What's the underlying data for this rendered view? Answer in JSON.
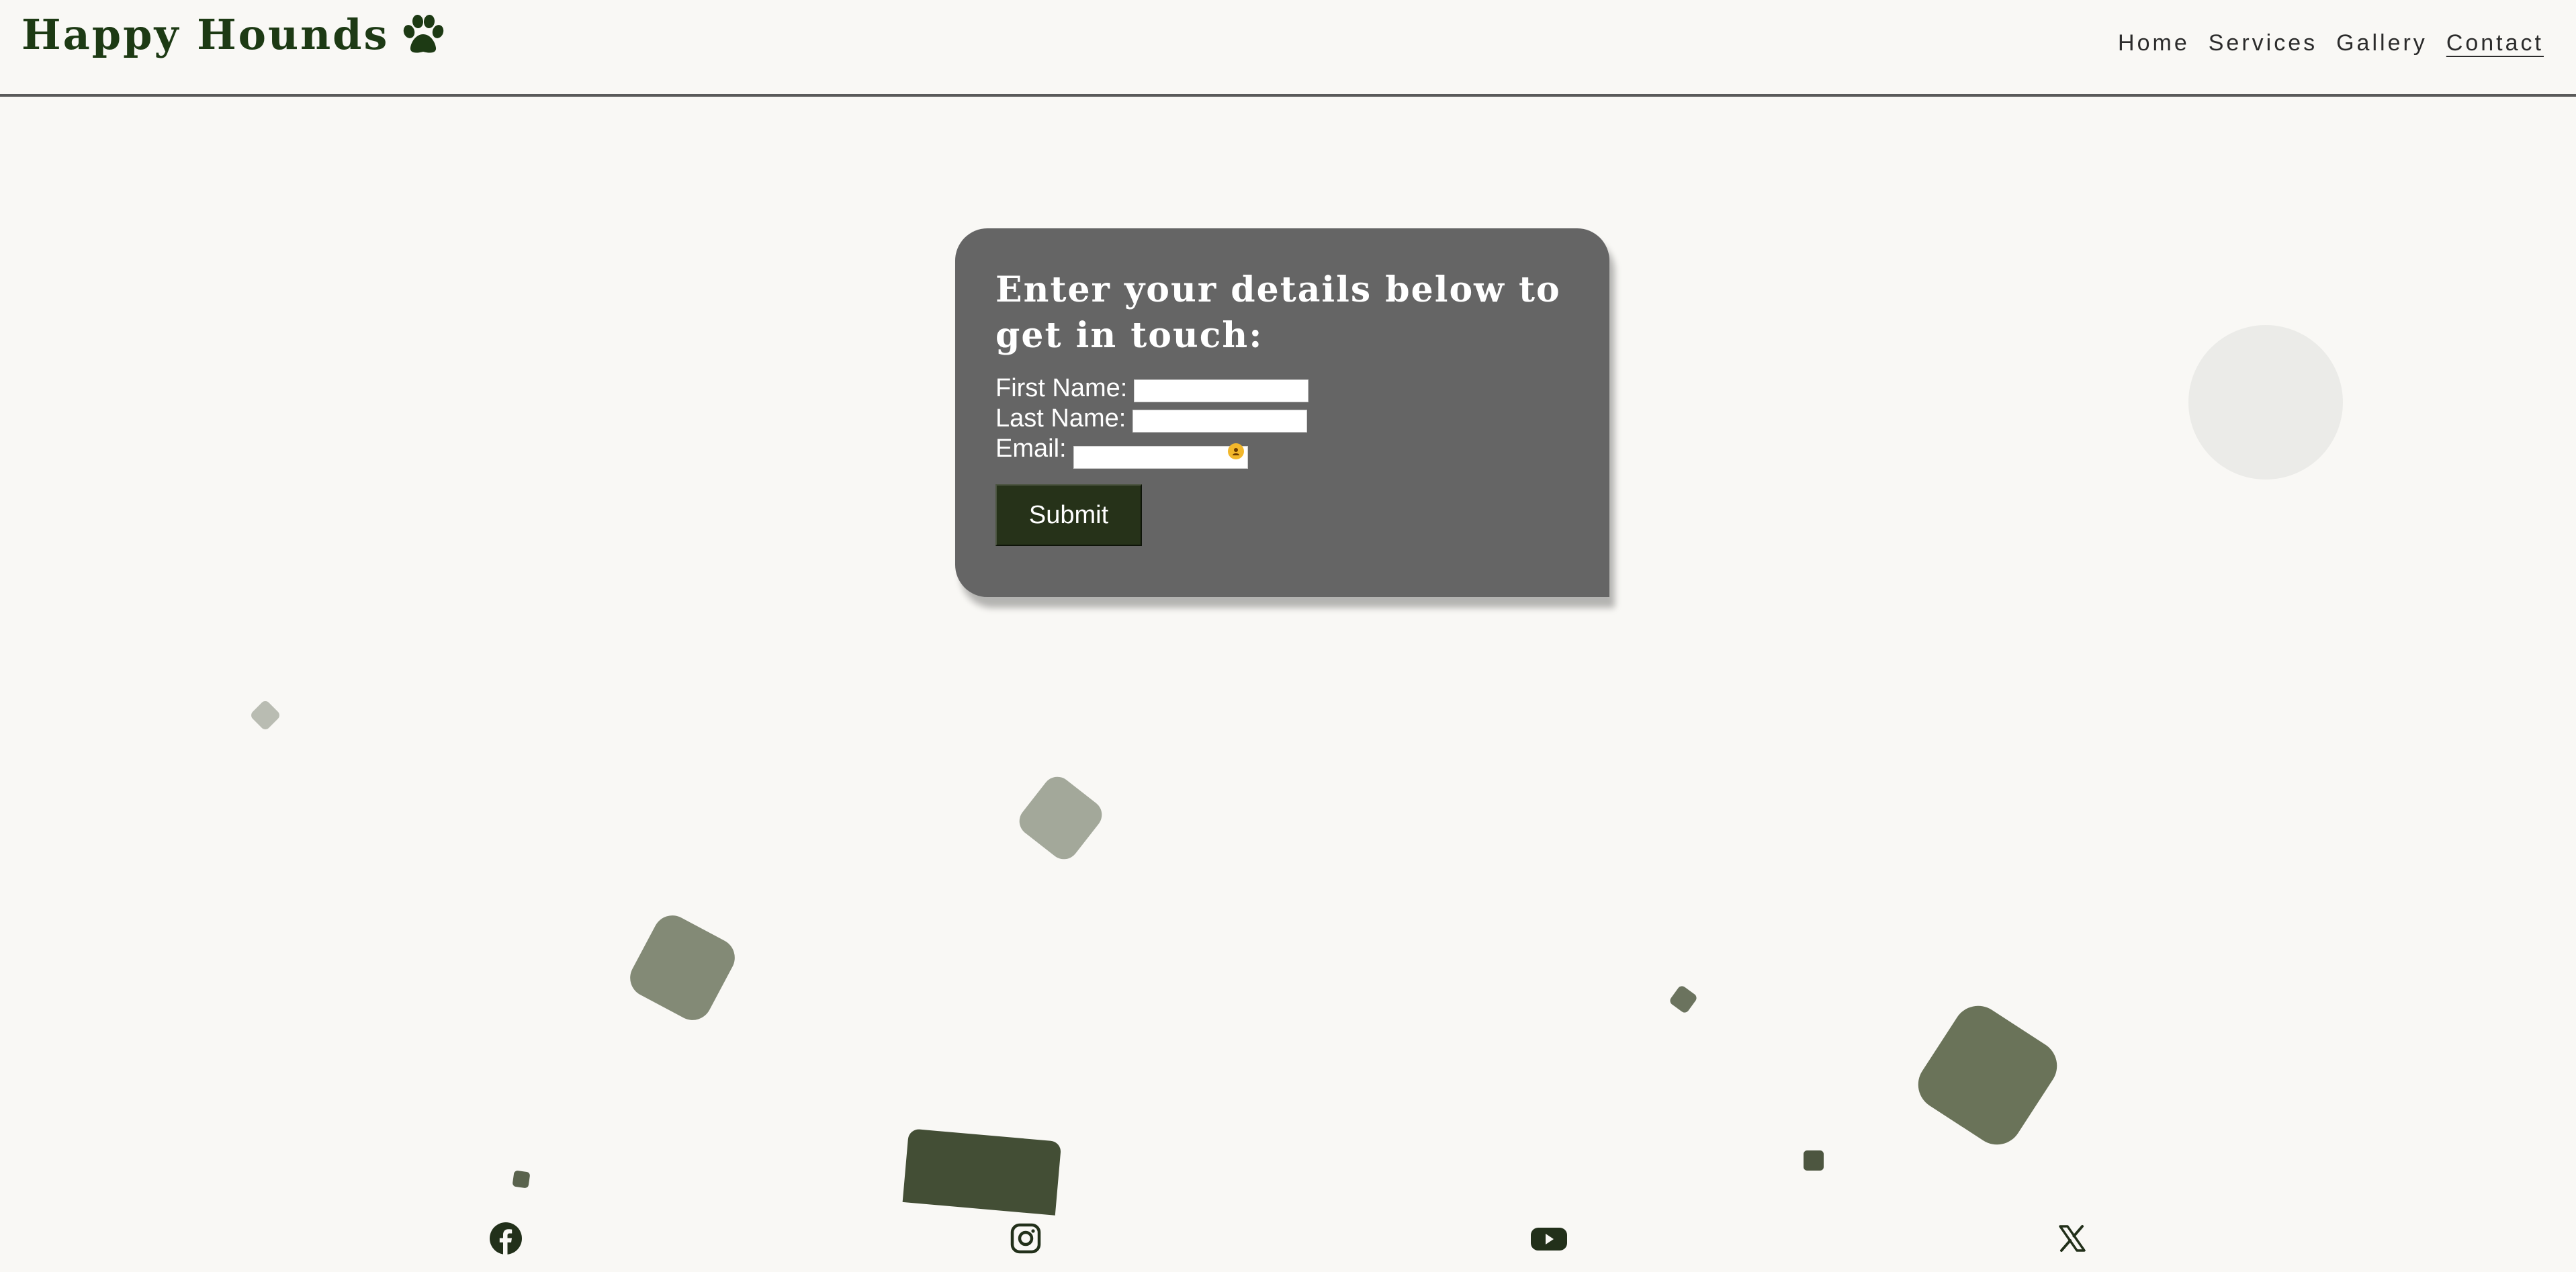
{
  "header": {
    "brand_title": "Happy Hounds",
    "brand_icon": "paw-icon",
    "nav": [
      {
        "label": "Home"
      },
      {
        "label": "Services"
      },
      {
        "label": "Gallery"
      },
      {
        "label": "Contact",
        "active": true
      }
    ]
  },
  "form": {
    "title": "Enter your details below to get in touch:",
    "first_name_label": "First Name:",
    "first_name_value": "",
    "last_name_label": "Last Name:",
    "last_name_value": "",
    "email_label": "Email:",
    "email_value": "",
    "submit_label": "Submit"
  },
  "footer": {
    "social": [
      {
        "icon": "facebook-icon"
      },
      {
        "icon": "instagram-icon"
      },
      {
        "icon": "youtube-icon"
      },
      {
        "icon": "x-icon"
      }
    ]
  },
  "colors": {
    "background": "#f9f8f5",
    "brand": "#1d3a14",
    "card": "#656565",
    "button": "#263219"
  }
}
